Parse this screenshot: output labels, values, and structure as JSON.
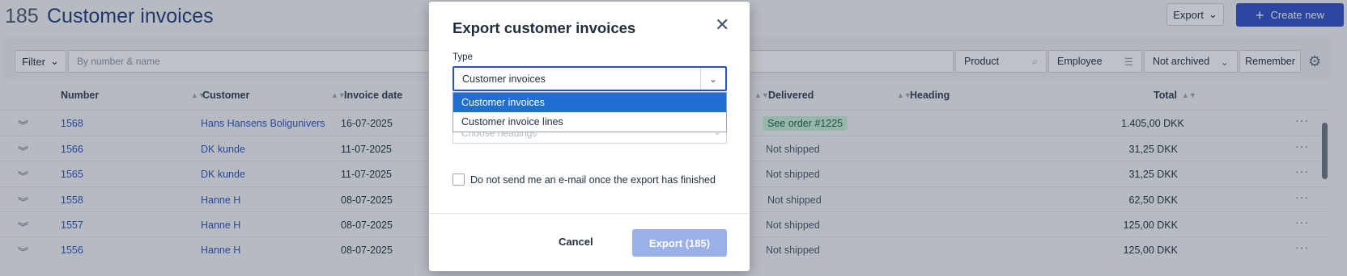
{
  "header": {
    "count": "185",
    "title": "Customer invoices",
    "export_label": "Export",
    "create_label": "Create new"
  },
  "filterbar": {
    "filter_label": "Filter",
    "search_placeholder": "By number & name",
    "product_label": "Product",
    "employee_label": "Employee",
    "archived_value": "Not archived",
    "remember_label": "Remember"
  },
  "table": {
    "columns": {
      "number": "Number",
      "customer": "Customer",
      "invoice_date": "Invoice date",
      "delivered": "Delivered",
      "heading": "Heading",
      "total": "Total"
    },
    "rows": [
      {
        "number": "1568",
        "customer": "Hans Hansens Boligunivers",
        "date": "16-07-2025",
        "delivered": "See order #1225",
        "total": "1.405,00 DKK"
      },
      {
        "number": "1566",
        "customer": "DK kunde",
        "date": "11-07-2025",
        "delivered": "Not shipped",
        "total": "31,25 DKK"
      },
      {
        "number": "1565",
        "customer": "DK kunde",
        "date": "11-07-2025",
        "delivered": "Not shipped",
        "total": "31,25 DKK"
      },
      {
        "number": "1558",
        "customer": "Hanne H",
        "date": "08-07-2025",
        "delivered": "Not shipped",
        "total": "62,50 DKK"
      },
      {
        "number": "1557",
        "customer": "Hanne H",
        "date": "08-07-2025",
        "delivered": "Not shipped",
        "total": "125,00 DKK"
      },
      {
        "number": "1556",
        "customer": "Hanne H",
        "date": "08-07-2025",
        "delivered": "Not shipped",
        "total": "125,00 DKK"
      }
    ]
  },
  "modal": {
    "title": "Export customer invoices",
    "type_label": "Type",
    "type_value": "Customer invoices",
    "options": [
      "Customer invoices",
      "Customer invoice lines"
    ],
    "headings_placeholder": "Choose headings",
    "checkbox_label": "Do not send me an e-mail once the export has finished",
    "cancel_label": "Cancel",
    "export_label": "Export (185)"
  },
  "colors": {
    "accent": "#2b4fc7",
    "selected_option": "#1f6fd1",
    "export_disabled": "#9bb0e8",
    "badge_bg": "#c9efd9"
  }
}
